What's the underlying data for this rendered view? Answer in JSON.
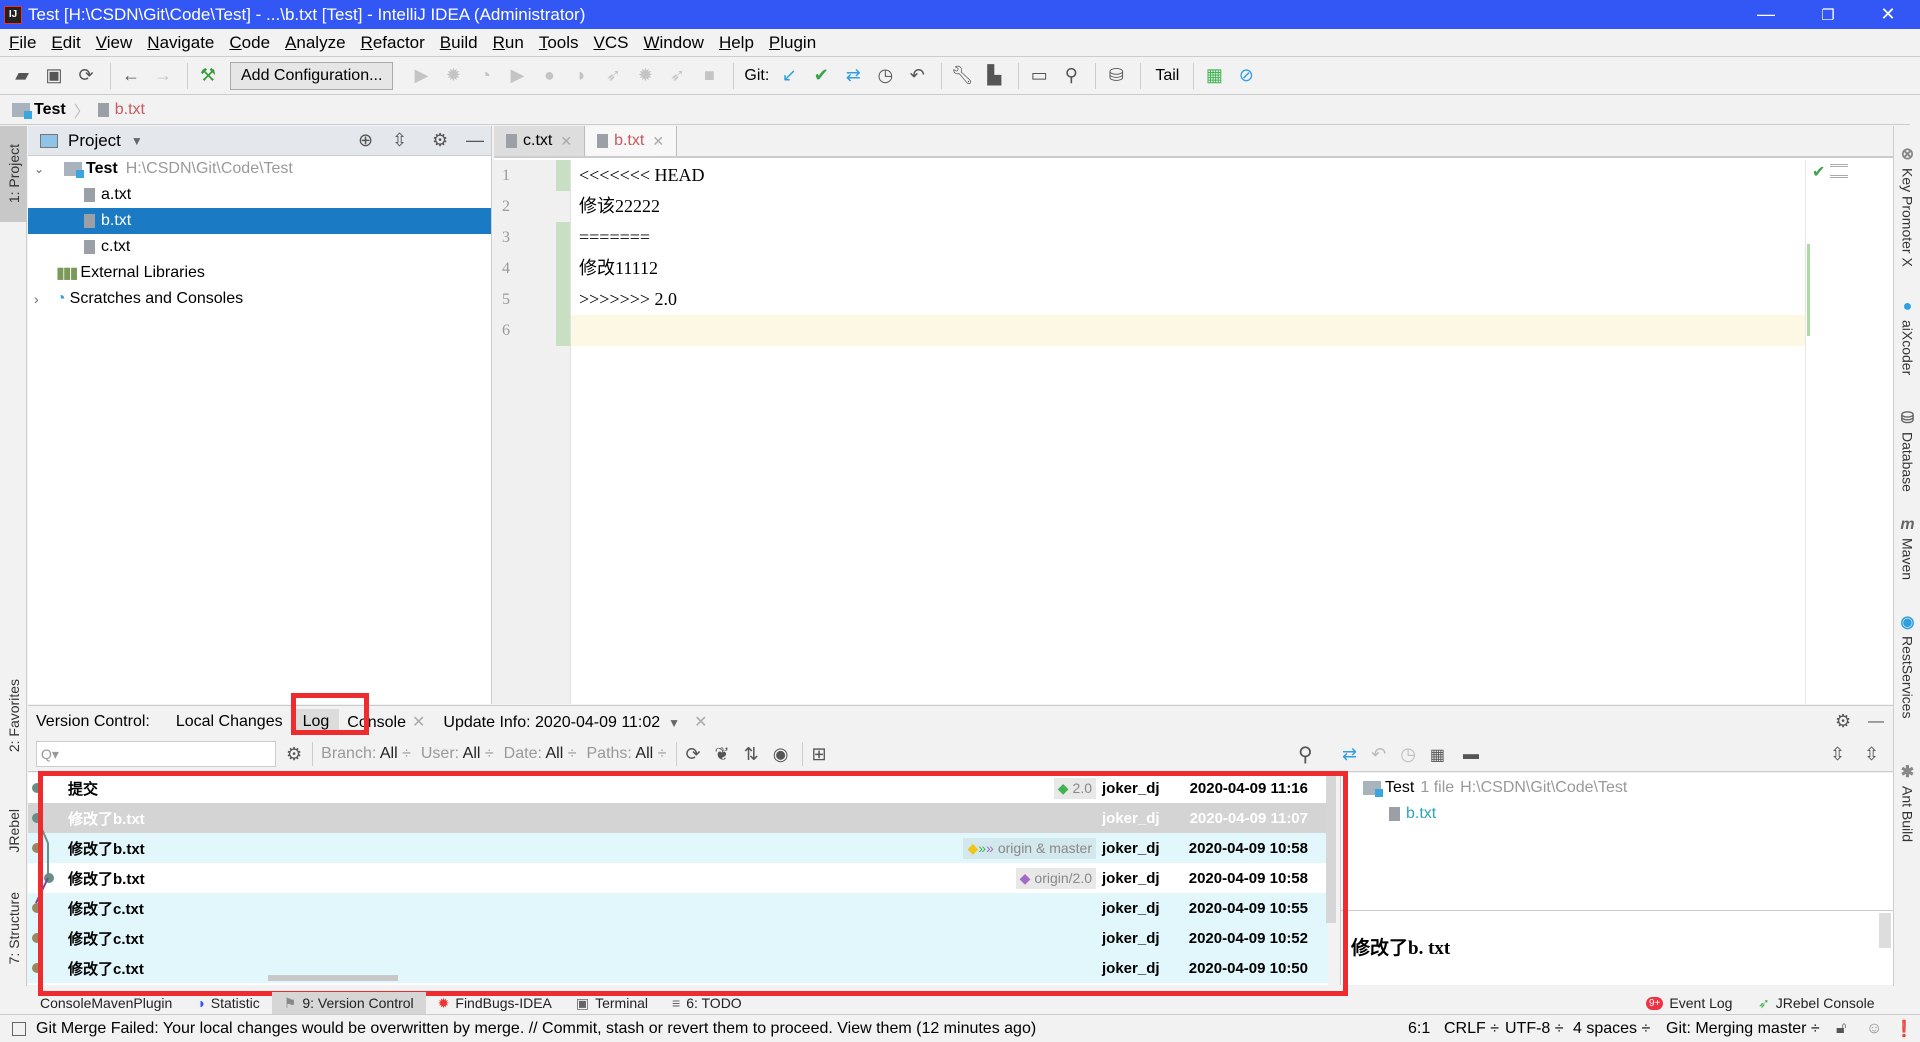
{
  "window": {
    "title": "Test [H:\\CSDN\\Git\\Code\\Test] - ...\\b.txt [Test] - IntelliJ IDEA (Administrator)",
    "minimize": "—",
    "restore": "❐",
    "close": "✕"
  },
  "menu": [
    "File",
    "Edit",
    "View",
    "Navigate",
    "Code",
    "Analyze",
    "Refactor",
    "Build",
    "Run",
    "Tools",
    "VCS",
    "Window",
    "Help",
    "Plugin"
  ],
  "toolbar": {
    "add_config": "Add Configuration...",
    "git_label": "Git:",
    "tail_label": "Tail"
  },
  "breadcrumb": {
    "project": "Test",
    "file": "b.txt"
  },
  "left_strip": {
    "project": "1: Project",
    "favorites": "2: Favorites",
    "jrebel": "JRebel",
    "structure": "7: Structure"
  },
  "right_strip": [
    "Key Promoter X",
    "aiXcoder",
    "Database",
    "Maven",
    "RestServices",
    "Ant Build"
  ],
  "project_panel": {
    "title": "Project",
    "tree": [
      {
        "label": "Test",
        "hint": "H:\\CSDN\\Git\\Code\\Test",
        "type": "root"
      },
      {
        "label": "a.txt",
        "type": "file"
      },
      {
        "label": "b.txt",
        "type": "file",
        "selected": true
      },
      {
        "label": "c.txt",
        "type": "file"
      },
      {
        "label": "External Libraries",
        "type": "lib"
      },
      {
        "label": "Scratches and Consoles",
        "type": "scratch"
      }
    ]
  },
  "editor": {
    "tabs": [
      {
        "label": "c.txt"
      },
      {
        "label": "b.txt",
        "active": true
      }
    ],
    "lines": [
      "<<<<<<< HEAD",
      "修该22222",
      "=======",
      "修改11112",
      ">>>>>>> 2.0",
      ""
    ]
  },
  "vc_panel": {
    "label": "Version Control:",
    "tabs": [
      "Local Changes",
      "Log",
      "Console",
      "Update Info: 2020-04-09 11:02"
    ],
    "search_placeholder": "Q▾",
    "filters": [
      {
        "k": "Branch:",
        "v": "All"
      },
      {
        "k": "User:",
        "v": "All"
      },
      {
        "k": "Date:",
        "v": "All"
      },
      {
        "k": "Paths:",
        "v": "All"
      }
    ]
  },
  "log": [
    {
      "msg": "提交",
      "ref": "2.0",
      "ref_type": "tag",
      "author": "joker_dj",
      "date": "2020-04-09 11:16"
    },
    {
      "msg": "修改了b.txt",
      "ref": "",
      "author": "joker_dj",
      "date": "2020-04-09 11:07",
      "selected": true
    },
    {
      "msg": "修改了b.txt",
      "ref": "origin & master",
      "ref_type": "branch",
      "author": "joker_dj",
      "date": "2020-04-09 10:58"
    },
    {
      "msg": "修改了b.txt",
      "ref": "origin/2.0",
      "ref_type": "remote",
      "author": "joker_dj",
      "date": "2020-04-09 10:58"
    },
    {
      "msg": "修改了c.txt",
      "ref": "",
      "author": "joker_dj",
      "date": "2020-04-09 10:55"
    },
    {
      "msg": "修改了c.txt",
      "ref": "",
      "author": "joker_dj",
      "date": "2020-04-09 10:52"
    },
    {
      "msg": "修改了c.txt",
      "ref": "",
      "author": "joker_dj",
      "date": "2020-04-09 10:50"
    }
  ],
  "changes": {
    "root": "Test",
    "count": "1 file",
    "path": "H:\\CSDN\\Git\\Code\\Test",
    "file": "b.txt",
    "commit_message": "修改了b. txt"
  },
  "bottom_tabs": [
    "ConsoleMavenPlugin",
    "Statistic",
    "9: Version Control",
    "FindBugs-IDEA",
    "Terminal",
    "6: TODO"
  ],
  "bottom_right": {
    "event_log": "Event Log",
    "event_badge": "9+",
    "jrebel_console": "JRebel Console"
  },
  "status": {
    "message": "Git Merge Failed: Your local changes would be overwritten by merge. // Commit, stash or revert them to proceed. View them (12 minutes ago)",
    "position": "6:1",
    "line_sep": "CRLF ÷",
    "encoding": "UTF-8 ÷",
    "indent": "4 spaces ÷",
    "branch": "Git: Merging master ÷"
  },
  "colors": {
    "accent": "#3357f5",
    "selection": "#1b7ac4",
    "highlight_box": "#ee2b2e",
    "log_row": "#e1f7fc"
  }
}
